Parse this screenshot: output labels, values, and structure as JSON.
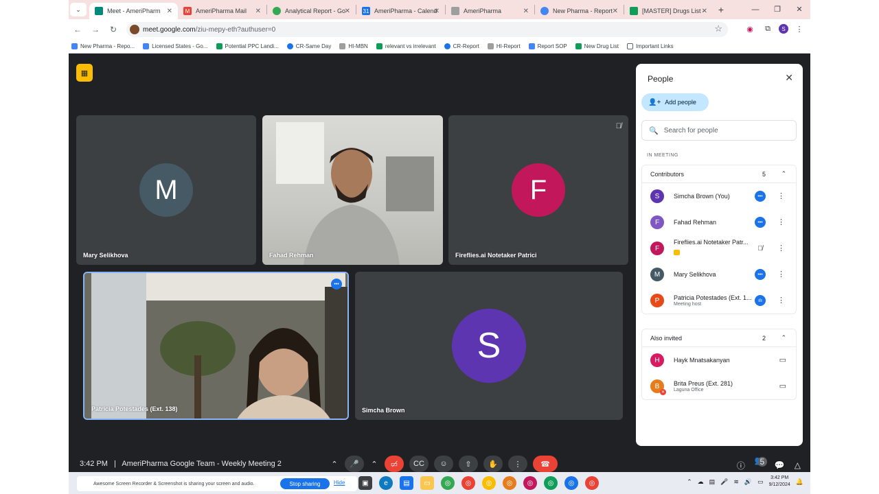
{
  "browser": {
    "tabs": [
      {
        "label": "Meet - AmeriPharm",
        "fav_color": "#00897b",
        "active": true
      },
      {
        "label": "AmeriPharma Mail",
        "fav_color": "#ea4335",
        "active": false
      },
      {
        "label": "Analytical Report - Go",
        "fav_color": "#34a853",
        "active": false
      },
      {
        "label": "AmeriPharma - Calend",
        "fav_color": "#1a73e8",
        "active": false
      },
      {
        "label": "AmeriPharma",
        "fav_color": "#9e9e9e",
        "active": false
      },
      {
        "label": "New Pharma - Report",
        "fav_color": "#4285f4",
        "active": false
      },
      {
        "label": "[MASTER] Drugs List -",
        "fav_color": "#0f9d58",
        "active": false
      }
    ],
    "url_host": "meet.google.com",
    "url_path": "/ziu-mepy-eth?authuser=0",
    "bookmarks": [
      {
        "label": "New Pharma - Repo...",
        "color": "#4285f4"
      },
      {
        "label": "Licensed States - Go...",
        "color": "#4285f4"
      },
      {
        "label": "Potential PPC Landi...",
        "color": "#0f9d58"
      },
      {
        "label": "CR-Same Day",
        "color": "#1a73e8"
      },
      {
        "label": "HI-MBN",
        "color": "#9e9e9e"
      },
      {
        "label": "relevant vs irrelevant",
        "color": "#0f9d58"
      },
      {
        "label": "CR-Report",
        "color": "#1a73e8"
      },
      {
        "label": "HI-Report",
        "color": "#9e9e9e"
      },
      {
        "label": "Report SOP",
        "color": "#4285f4"
      },
      {
        "label": "New Drug List",
        "color": "#0f9d58"
      },
      {
        "label": "Important Links",
        "color": "#9e9e9e"
      }
    ],
    "profile_initial": "S"
  },
  "meet": {
    "tiles": {
      "mary": {
        "name": "Mary Selikhova",
        "initial": "M",
        "color": "#455a64"
      },
      "fahad": {
        "name": "Fahad Rehman"
      },
      "fireflies": {
        "name": "Fireflies.ai Notetaker Patrici",
        "initial": "F",
        "color": "#c2185b"
      },
      "patricia": {
        "name": "Patricia Potestades (Ext. 138)"
      },
      "simcha": {
        "name": "Simcha Brown",
        "initial": "S",
        "color": "#5e35b1"
      }
    },
    "time": "3:42 PM",
    "separator": "|",
    "meeting_title": "AmeriPharma Google Team - Weekly Meeting 2",
    "participant_count": "5"
  },
  "people_panel": {
    "title": "People",
    "add_people_label": "Add people",
    "search_placeholder": "Search for people",
    "section_label": "IN MEETING",
    "contributors": {
      "label": "Contributors",
      "count": "5",
      "people": [
        {
          "name": "Simcha Brown (You)",
          "sub": "",
          "initial": "S",
          "color": "#5e35b1",
          "status": "speaking"
        },
        {
          "name": "Fahad Rehman",
          "sub": "",
          "initial": "F",
          "color": "#7e57c2",
          "status": "speaking"
        },
        {
          "name": "Fireflies.ai Notetaker Patr...",
          "sub": "",
          "initial": "F",
          "color": "#c2185b",
          "status": "muted"
        },
        {
          "name": "Mary Selikhova",
          "sub": "",
          "initial": "M",
          "color": "#455a64",
          "status": "speaking"
        },
        {
          "name": "Patricia Potestades (Ext. 1...",
          "sub": "Meeting host",
          "initial": "P",
          "color": "#e64a19",
          "status": "active"
        }
      ]
    },
    "also_invited": {
      "label": "Also invited",
      "count": "2",
      "people": [
        {
          "name": "Hayk Mnatsakanyan",
          "sub": "",
          "initial": "H",
          "color": "#d81b60"
        },
        {
          "name": "Brita Preus (Ext. 281)",
          "sub": "Laguna Office",
          "initial": "B",
          "color": "#e67c1c"
        }
      ]
    }
  },
  "taskbar": {
    "share_text": "Awesome Screen Recorder & Screenshot is sharing your screen and audio.",
    "stop_label": "Stop sharing",
    "hide_label": "Hide",
    "time": "3:42 PM",
    "date": "9/12/2024"
  }
}
